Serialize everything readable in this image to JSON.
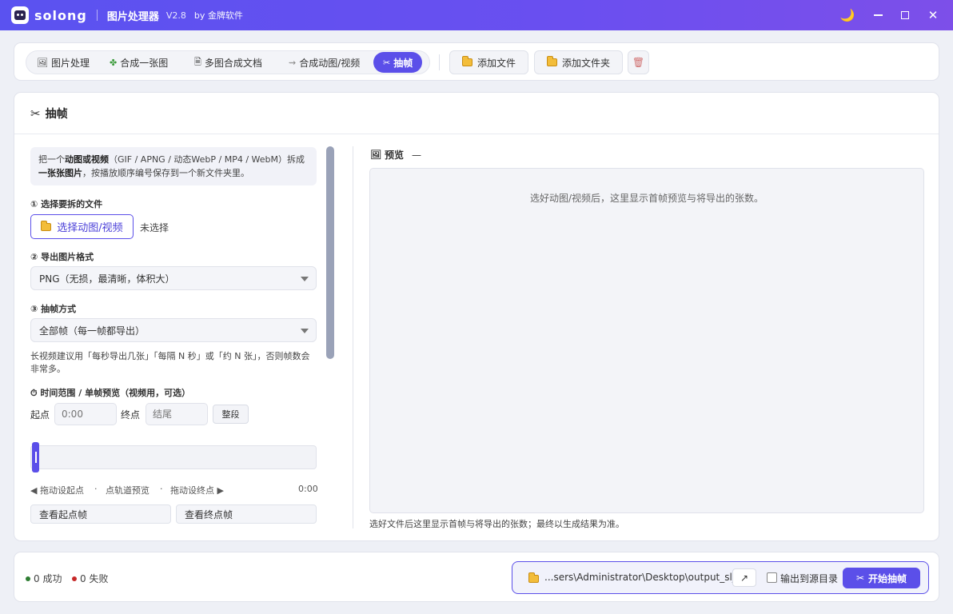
{
  "titlebar": {
    "brand": "solong",
    "app_title": "图片处理器",
    "version": "V2.8",
    "by": "by 金牌软件",
    "theme_icon": "moon-icon"
  },
  "tabs": [
    {
      "label": "图片处理",
      "icon": "frame-icon",
      "active": false
    },
    {
      "label": "合成一张图",
      "icon": "clover-icon",
      "active": false
    },
    {
      "label": "多图合成文档",
      "icon": "document-icon",
      "active": false
    },
    {
      "label": "合成动图/视频",
      "icon": "link-icon",
      "active": false
    },
    {
      "label": "抽帧",
      "icon": "scissors-icon",
      "active": true
    }
  ],
  "toolbar": {
    "add_file": "添加文件",
    "add_folder": "添加文件夹",
    "clear_icon": "trash-icon"
  },
  "panel": {
    "title": "抽帧",
    "info_pre": "把一个",
    "info_bold1": "动图或视频",
    "info_mid": "（GIF / APNG / 动态WebP / MP4 / WebM）拆成",
    "info_bold2": "一张张图片",
    "info_post": "，按播放顺序编号保存到一个新文件夹里。",
    "step1": "① 选择要拆的文件",
    "pick_button": "选择动图/视频",
    "no_file": "未选择",
    "step2": "② 导出图片格式",
    "format_value": "PNG（无损，最清晰，体积大）",
    "step3": "③ 抽帧方式",
    "mode_value": "全部帧（每一帧都导出）",
    "hint": "长视频建议用「每秒导出几张」「每隔 N 秒」或「约 N 张」，否则帧数会非常多。",
    "time_range_label": "⏱ 时间范围 / 单帧预览（视频用，可选）",
    "start_label": "起点",
    "start_placeholder": "0:00",
    "end_label": "终点",
    "end_placeholder": "结尾",
    "whole_button": "整段",
    "hint_drag_start": "◀ 拖动设起点",
    "hint_sep": "·",
    "hint_click_track": "点轨道预览",
    "hint_drag_end": "拖动设终点 ▶",
    "time_readout": "0:00",
    "view_start_frame": "查看起点帧",
    "view_end_frame": "查看终点帧"
  },
  "preview": {
    "label": "预览",
    "dash": "—",
    "empty_message": "选好动图/视频后，这里显示首帧预览与将导出的张数。",
    "note": "选好文件后这里显示首帧与将导出的张数；最终以生成结果为准。"
  },
  "footer": {
    "success": "0 成功",
    "fail": "0 失败",
    "success_color": "#2e7d32",
    "fail_color": "#c62828",
    "output_path": "...sers\\Administrator\\Desktop\\output_sl_ip",
    "open_icon": "↗",
    "output_to_source": "输出到源目录",
    "start_button": "开始抽帧"
  },
  "colors": {
    "accent": "#5b4fe9"
  }
}
